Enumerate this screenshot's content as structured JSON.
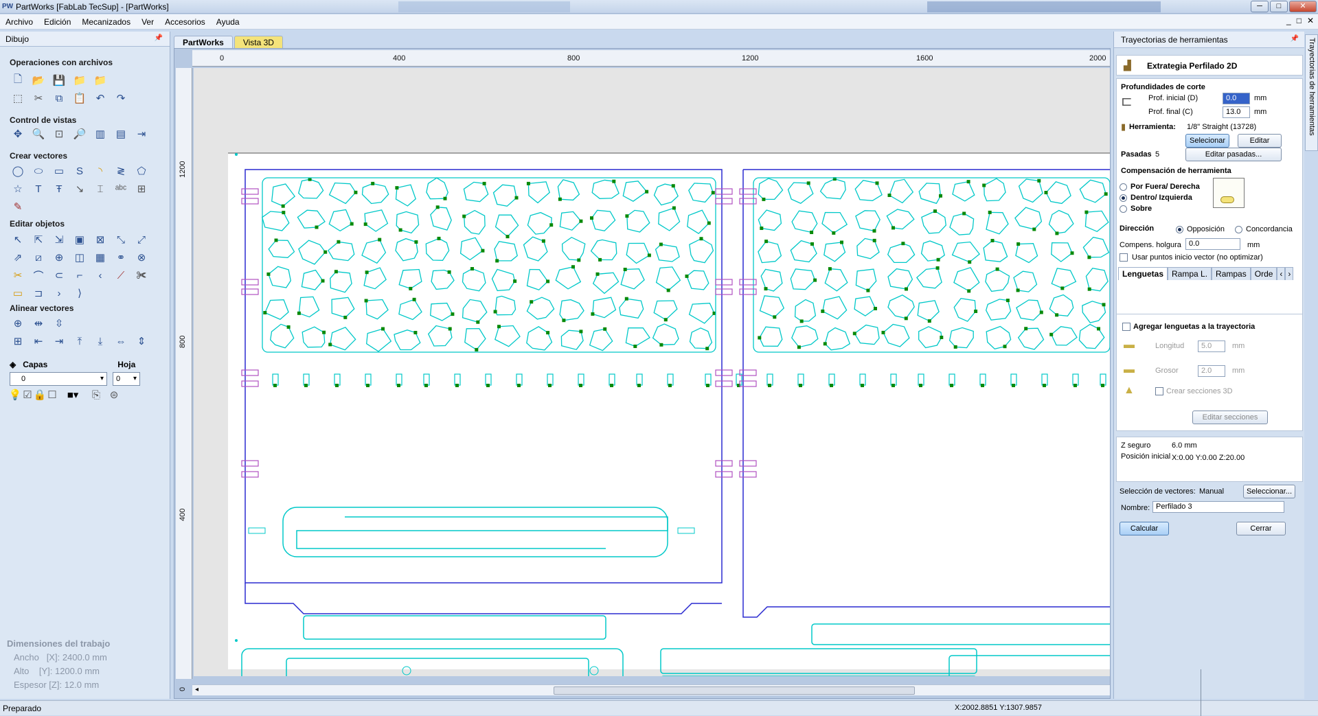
{
  "window": {
    "logo": "PW",
    "title": "PartWorks [FabLab TecSup] - [PartWorks]",
    "controls": [
      "─",
      "□",
      "✕"
    ]
  },
  "menu": [
    "Archivo",
    "Edición",
    "Mecanizados",
    "Ver",
    "Accesorios",
    "Ayuda"
  ],
  "mdi_controls": [
    "_",
    "□",
    "✕"
  ],
  "left_panel": {
    "header": "Dibujo",
    "sections": {
      "files": "Operaciones con archivos",
      "views": "Control de vistas",
      "create": "Crear vectores",
      "edit": "Editar objetos",
      "align": "Alinear vectores"
    },
    "capas_label": "Capas",
    "hoja_label": "Hoja",
    "layer_value": "0",
    "sheet_value": "0",
    "job": {
      "title": "Dimensiones del trabajo",
      "width": "Ancho   [X]: 2400.0 mm",
      "height": "Alto    [Y]: 1200.0 mm",
      "thickness": "Espesor [Z]: 12.0 mm"
    }
  },
  "doc_tabs": [
    "PartWorks",
    "Vista 3D"
  ],
  "rulers": {
    "top": [
      "0",
      "400",
      "800",
      "1200",
      "1600",
      "2000"
    ],
    "left": [
      "1200",
      "800",
      "400",
      "0"
    ]
  },
  "right_panel": {
    "header": "Trayectorias de herramientas",
    "strategy": "Extrategia Perfilado 2D",
    "depths_title": "Profundidades de corte",
    "start_depth_label": "Prof. inicial (D)",
    "start_depth_value": "0.0",
    "final_depth_label": "Prof. final (C)",
    "final_depth_value": "13.0",
    "unit": "mm",
    "tool_label": "Herramienta:",
    "tool_value": "1/8\" Straight (13728)",
    "select_btn": "Selecionar",
    "edit_btn": "Editar",
    "passes_label": "Pasadas",
    "passes_value": "5",
    "edit_passes_btn": "Editar pasadas...",
    "comp_title": "Compensación de herramienta",
    "comp_options": [
      "Por Fuera/ Derecha",
      "Dentro/ Izquierda",
      "Sobre"
    ],
    "direction_label": "Dirección",
    "direction_options": [
      "Opposición",
      "Concordancia"
    ],
    "allowance_label": "Compens. holgura",
    "allowance_value": "0.0",
    "vector_start": "Usar puntos inicio vector (no optimizar)",
    "tabs": [
      "Lenguetas",
      "Rampa L.",
      "Rampas",
      "Orde"
    ],
    "tabs_add": "Agregar lenguetas a la trayectoria",
    "length_label": "Longitud",
    "length_value": "5.0",
    "thick_label": "Grosor",
    "thick_value": "2.0",
    "sections3d": "Crear secciones 3D",
    "edit_sections_btn": "Editar secciones",
    "zsafe_label": "Z seguro",
    "zsafe_value": "6.0 mm",
    "home_label": "Posición inicial",
    "home_value": "X:0.00 Y:0.00 Z:20.00",
    "vector_sel_label": "Selección de vectores:",
    "vector_sel_value": "Manual",
    "vector_sel_btn": "Seleccionar...",
    "name_label": "Nombre:",
    "name_value": "Perfilado 3",
    "calc_btn": "Calcular",
    "close_btn": "Cerrar"
  },
  "vertical_tab": "Trayectorias de herramientas",
  "status": {
    "left": "Preparado",
    "coords": "X:2002.8851 Y:1307.9857"
  },
  "colors": {
    "toolpath": "#00c8c8",
    "sheet_outline": "#2a2ad0",
    "node": "#0a8a0a",
    "tab_marker": "#b050c0"
  }
}
